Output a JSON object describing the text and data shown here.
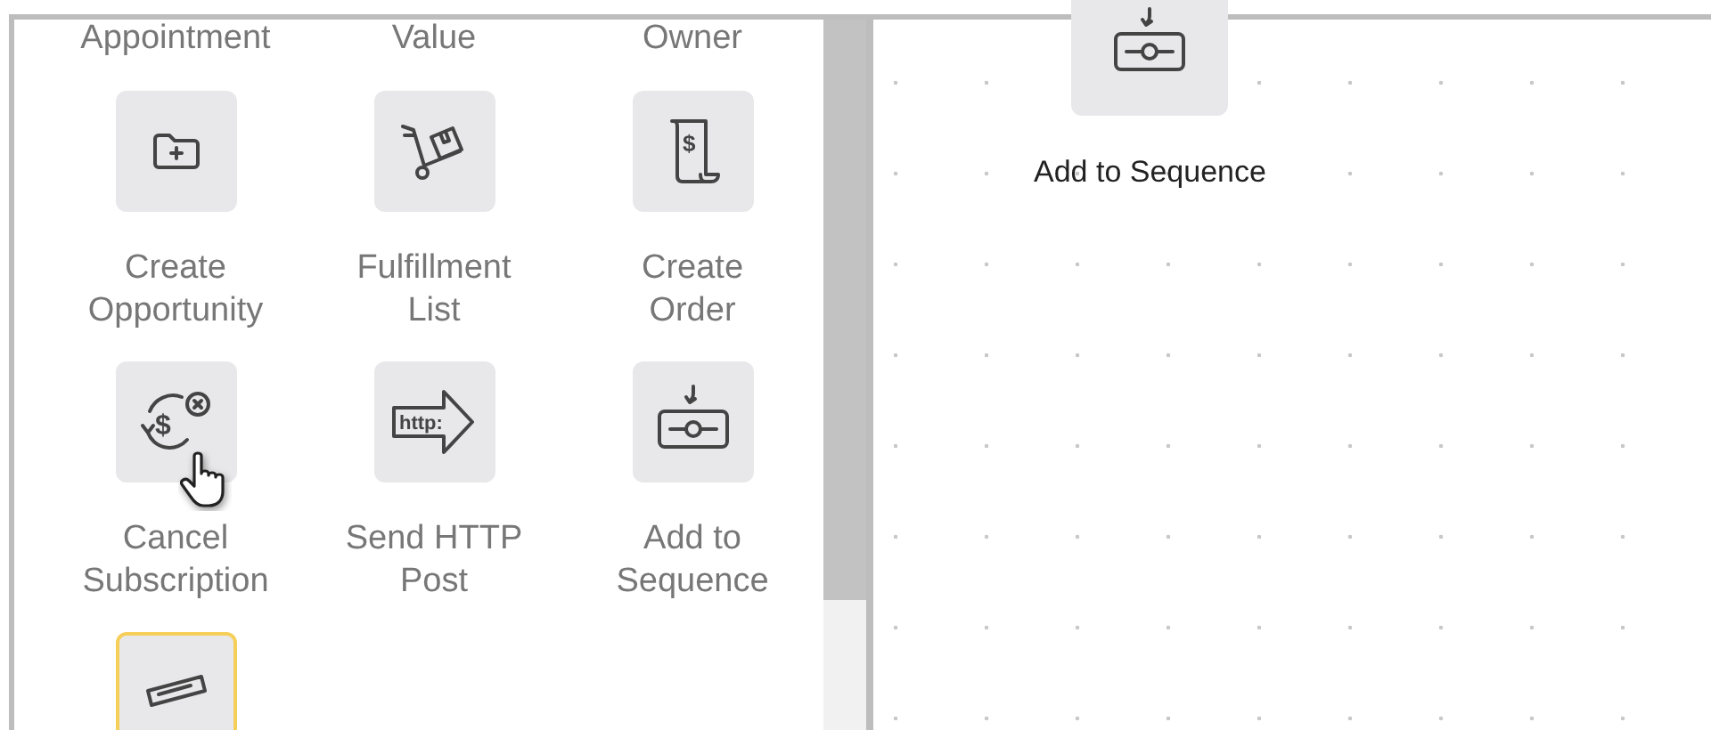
{
  "palette": {
    "cut_labels": [
      "Appointment",
      "Value",
      "Owner"
    ],
    "items": [
      {
        "lines": [
          "Create",
          "Opportunity"
        ],
        "hovered": false,
        "selected": false
      },
      {
        "lines": [
          "Fulfillment",
          "List"
        ],
        "hovered": false,
        "selected": false
      },
      {
        "icon_text": "$",
        "lines": [
          "Create",
          "Order"
        ],
        "hovered": false,
        "selected": false
      },
      {
        "icon_text": "$",
        "lines": [
          "Cancel",
          "Subscription"
        ],
        "hovered": true,
        "selected": false
      },
      {
        "icon_text": "http:",
        "lines": [
          "Send HTTP",
          "Post"
        ],
        "hovered": false,
        "selected": false
      },
      {
        "lines": [
          "Add to",
          "Sequence"
        ],
        "hovered": false,
        "selected": false
      },
      {
        "hovered": false,
        "selected": true
      }
    ]
  },
  "canvas": {
    "nodes": [
      {
        "label": "Add to Sequence"
      }
    ]
  }
}
